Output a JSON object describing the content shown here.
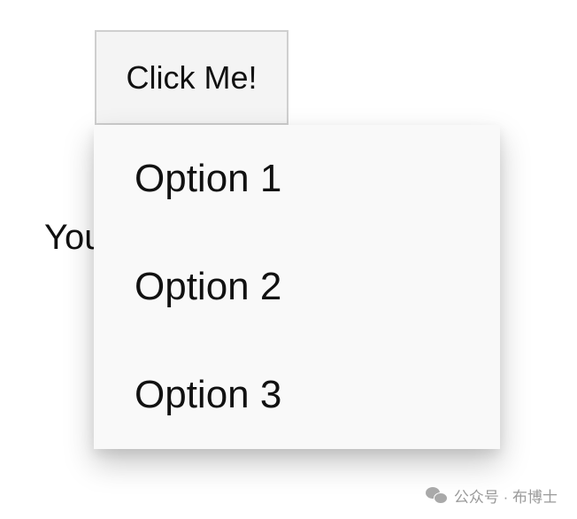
{
  "button": {
    "label": "Click Me!"
  },
  "background_text": {
    "visible_fragment": "You"
  },
  "dropdown": {
    "options": [
      {
        "label": "Option 1"
      },
      {
        "label": "Option 2"
      },
      {
        "label": "Option 3"
      }
    ]
  },
  "watermark": {
    "icon": "wechat-icon",
    "text": "公众号 · 布博士"
  },
  "colors": {
    "menu_background": "#f9f9f9",
    "button_background": "#f4f4f4",
    "button_border": "#cfcfcf",
    "text": "#111111"
  }
}
